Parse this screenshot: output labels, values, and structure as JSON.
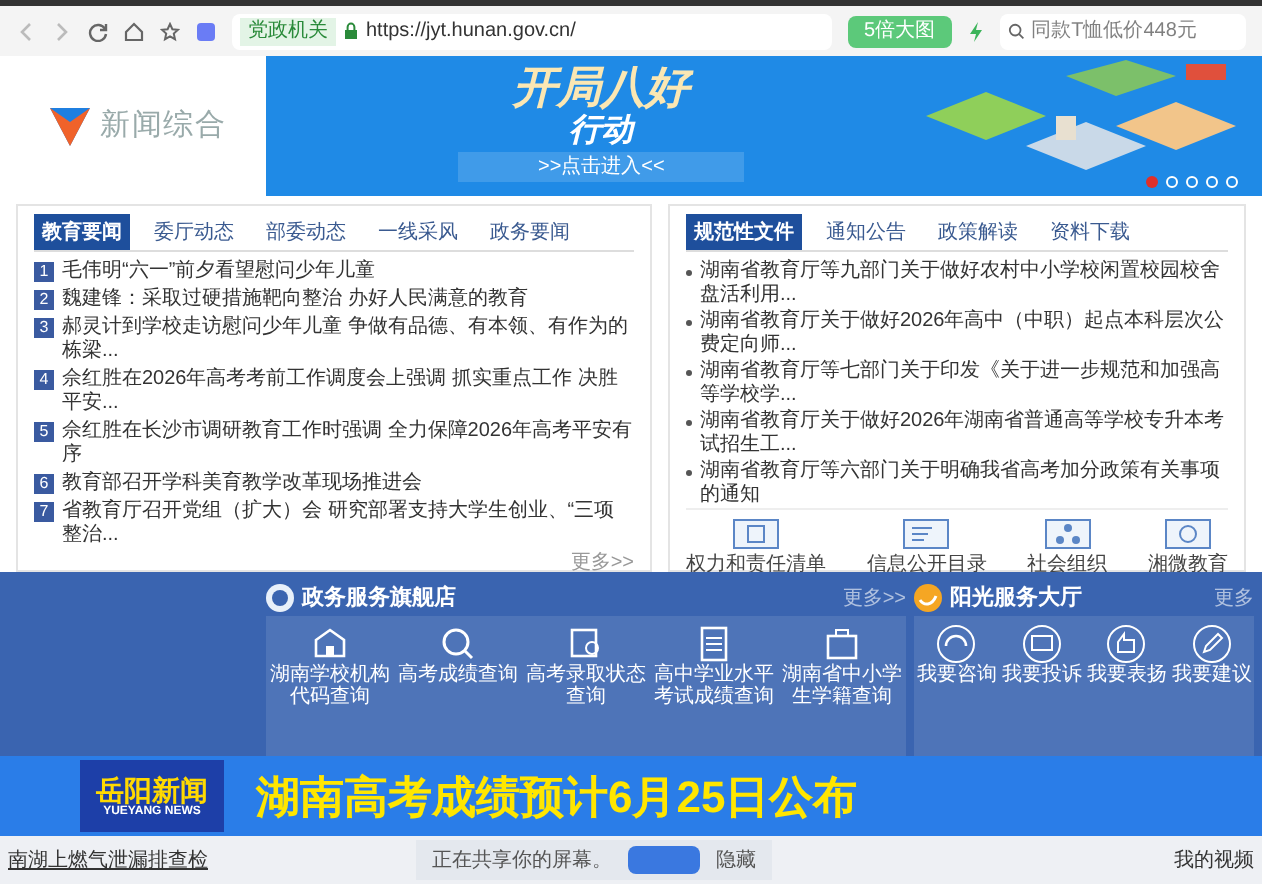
{
  "browser": {
    "address": {
      "badge": "党政机关",
      "url": "https://jyt.hunan.gov.cn/"
    },
    "toolbar_button": "5倍大图",
    "search": {
      "placeholder": "同款T恤低价448元"
    }
  },
  "channel_logo": "新闻综合",
  "banner": {
    "title": "开局八好",
    "subtitle": "行动",
    "link": ">>点击进入<<",
    "dots": [
      {
        "selected": true
      },
      {
        "selected": false
      },
      {
        "selected": false
      },
      {
        "selected": false
      },
      {
        "selected": false
      }
    ]
  },
  "news_panel": {
    "tabs": [
      {
        "label": "教育要闻",
        "selected": true
      },
      {
        "label": "委厅动态",
        "selected": false
      },
      {
        "label": "部委动态",
        "selected": false
      },
      {
        "label": "一线采风",
        "selected": false
      },
      {
        "label": "政务要闻",
        "selected": false
      }
    ],
    "items": [
      {
        "number": "1",
        "text": "毛伟明“六一”前夕看望慰问少年儿童"
      },
      {
        "number": "2",
        "text": "魏建锋：采取过硬措施靶向整治 办好人民满意的教育"
      },
      {
        "number": "3",
        "text": "郝灵计到学校走访慰问少年儿童 争做有品德、有本领、有作为的栋梁..."
      },
      {
        "number": "4",
        "text": "佘红胜在2026年高考考前工作调度会上强调 抓实重点工作 决胜平安..."
      },
      {
        "number": "5",
        "text": "佘红胜在长沙市调研教育工作时强调 全力保障2026年高考平安有序"
      },
      {
        "number": "6",
        "text": "教育部召开学科美育教学改革现场推进会"
      },
      {
        "number": "7",
        "text": "省教育厅召开党组（扩大）会 研究部署支持大学生创业、“三项整治..."
      }
    ],
    "more": "更多>>"
  },
  "docs_panel": {
    "tabs": [
      {
        "label": "规范性文件",
        "selected": true
      },
      {
        "label": "通知公告",
        "selected": false
      },
      {
        "label": "政策解读",
        "selected": false
      },
      {
        "label": "资料下载",
        "selected": false
      }
    ],
    "items": [
      "湖南省教育厅等九部门关于做好农村中小学校闲置校园校舍盘活利用...",
      "湖南省教育厅关于做好2026年高中（中职）起点本科层次公费定向师...",
      "湖南省教育厅等七部门关于印发《关于进一步规范和加强高等学校学...",
      "湖南省教育厅关于做好2026年湖南省普通高等学校专升本考试招生工...",
      "湖南省教育厅等六部门关于明确我省高考加分政策有关事项的通知"
    ],
    "links": [
      {
        "kind": "list",
        "label": "权力和责任清单"
      },
      {
        "kind": "catalog",
        "label": "信息公开目录"
      },
      {
        "kind": "org",
        "label": "社会组织"
      },
      {
        "kind": "chat",
        "label": "湘微教育"
      }
    ]
  },
  "gov_services": {
    "title": "政务服务旗舰店",
    "more": "更多>>",
    "items": [
      {
        "kind": "school",
        "label": "湖南学校机构代码查询"
      },
      {
        "kind": "search",
        "label": "高考成绩查询"
      },
      {
        "kind": "status",
        "label": "高考录取状态查询"
      },
      {
        "kind": "score",
        "label": "高中学业水平考试成绩查询"
      },
      {
        "kind": "case",
        "label": "湖南省中小学生学籍查询"
      }
    ]
  },
  "sunshine_hall": {
    "title": "阳光服务大厅",
    "more": "更多",
    "items": [
      {
        "kind": "headset",
        "label": "我要咨询"
      },
      {
        "kind": "message",
        "label": "我要投诉"
      },
      {
        "kind": "thumb",
        "label": "我要表扬"
      },
      {
        "kind": "edit",
        "label": "我要建议"
      }
    ]
  },
  "caption": {
    "logo": "岳阳新闻",
    "logo_en": "YUEYANG NEWS",
    "headline": "湖南高考成绩预计6月25日公布"
  },
  "status_bar": {
    "link": "南湖上燃气泄漏排查检",
    "share_notice": "正在共享你的屏幕。",
    "hide": "隐藏",
    "right": "我的视频"
  }
}
